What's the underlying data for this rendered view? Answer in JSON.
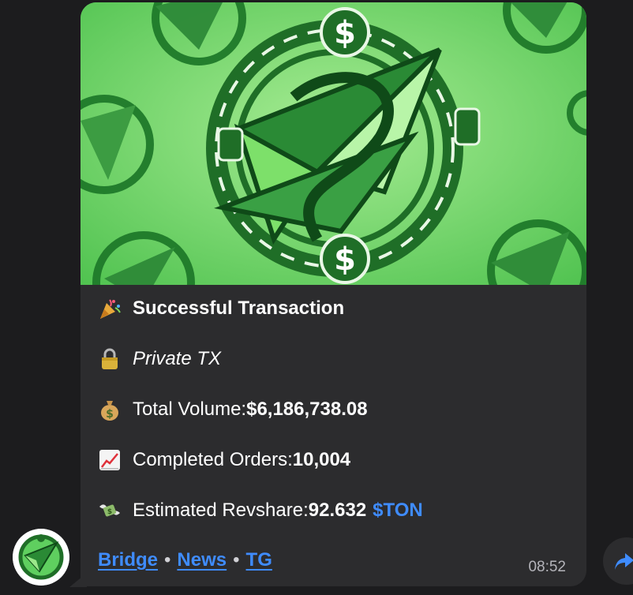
{
  "message": {
    "heading": "Successful Transaction",
    "privacy": "Private TX",
    "volume_label": "Total Volume: ",
    "volume_value": "$6,186,738.08",
    "orders_label": "Completed Orders: ",
    "orders_value": "10,004",
    "revshare_label": "Estimated Revshare: ",
    "revshare_value": "92.632",
    "revshare_unit": "$TON",
    "links": [
      "Bridge",
      "News",
      "TG"
    ],
    "link_separator": "•",
    "time": "08:52"
  },
  "icons": {
    "heading": "party-popper-icon",
    "privacy": "lock-icon",
    "volume": "money-bag-icon",
    "orders": "chart-increasing-icon",
    "revshare": "money-with-wings-icon",
    "share": "share-arrow-icon",
    "avatar": "green-arrow-logo-icon"
  },
  "colors": {
    "background": "#1c1c1e",
    "bubble": "#2c2c2e",
    "link": "#3f8cff",
    "text": "#ffffff",
    "timestamp": "#b4b4ba",
    "media_green": "#5fcf5f"
  }
}
